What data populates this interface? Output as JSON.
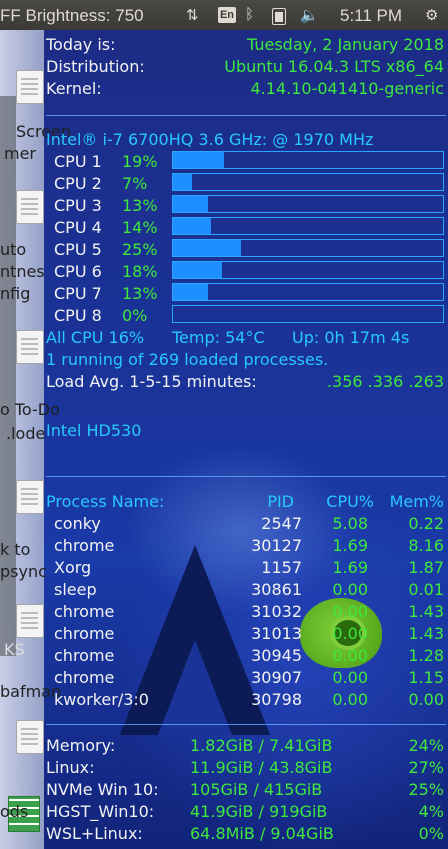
{
  "topbar": {
    "brightness": "FF Brightness: 750",
    "keyboard": "En",
    "time": "5:11 PM",
    "icons": [
      "sync-arrows-icon",
      "keyboard-layout-icon",
      "bluetooth-icon",
      "battery-icon",
      "volume-icon",
      "settings-gear-icon"
    ]
  },
  "dock": {
    "labels": [
      "Screen",
      "mer",
      "uto",
      "ntnes",
      "nfig",
      "o To-Do",
      ".lode",
      "k to",
      "psync",
      "KS",
      "bafman",
      "ods"
    ]
  },
  "system": {
    "today_label": "Today is:",
    "today_value": "Tuesday,  2 January 2018",
    "dist_label": "Distribution:",
    "dist_value": "Ubuntu 16.04.3 LTS x86_64",
    "kernel_label": "Kernel:",
    "kernel_value": "4.14.10-041410-generic"
  },
  "cpu": {
    "model": "Intel® i-7 6700HQ 3.6 GHz: @  1970 MHz",
    "cores": [
      {
        "label": "CPU 1",
        "pct": "19%",
        "value": 19
      },
      {
        "label": "CPU 2",
        "pct": "7%",
        "value": 7
      },
      {
        "label": "CPU 3",
        "pct": "13%",
        "value": 13
      },
      {
        "label": "CPU 4",
        "pct": "14%",
        "value": 14
      },
      {
        "label": "CPU 5",
        "pct": "25%",
        "value": 25
      },
      {
        "label": "CPU 6",
        "pct": "18%",
        "value": 18
      },
      {
        "label": "CPU 7",
        "pct": "13%",
        "value": 13
      },
      {
        "label": "CPU 8",
        "pct": "0%",
        "value": 0
      }
    ],
    "all_cpu": "All CPU 16%",
    "temp": "Temp: 54°C",
    "uptime": "Up: 0h 17m 4s",
    "processes": "1 running of 269 loaded processes.",
    "load_label": "Load Avg. 1-5-15 minutes:",
    "load_value": ".356 .336 .263",
    "gpu": "Intel HD530"
  },
  "processes": {
    "headers": {
      "name": "Process Name:",
      "pid": "PID",
      "cpu": "CPU%",
      "mem": "Mem%"
    },
    "rows": [
      {
        "name": "conky",
        "pid": "2547",
        "cpu": "5.08",
        "mem": "0.22"
      },
      {
        "name": "chrome",
        "pid": "30127",
        "cpu": "1.69",
        "mem": "8.16"
      },
      {
        "name": "Xorg",
        "pid": "1157",
        "cpu": "1.69",
        "mem": "1.87"
      },
      {
        "name": "sleep",
        "pid": "30861",
        "cpu": "0.00",
        "mem": "0.01"
      },
      {
        "name": "chrome",
        "pid": "31032",
        "cpu": "0.00",
        "mem": "1.43"
      },
      {
        "name": "chrome",
        "pid": "31013",
        "cpu": "0.00",
        "mem": "1.43"
      },
      {
        "name": "chrome",
        "pid": "30945",
        "cpu": "0.00",
        "mem": "1.28"
      },
      {
        "name": "chrome",
        "pid": "30907",
        "cpu": "0.00",
        "mem": "1.15"
      },
      {
        "name": "kworker/3:0",
        "pid": "30798",
        "cpu": "0.00",
        "mem": "0.00"
      }
    ]
  },
  "storage": {
    "rows": [
      {
        "name": "Memory:",
        "used": "1.82GiB / 7.41GiB",
        "pct": "24%"
      },
      {
        "name": "Linux:",
        "used": "11.9GiB / 43.8GiB",
        "pct": "27%"
      },
      {
        "name": "NVMe Win 10:",
        "used": "105GiB / 415GiB",
        "pct": "25%"
      },
      {
        "name": "HGST_Win10:",
        "used": "41.9GiB / 919GiB",
        "pct": "4%"
      },
      {
        "name": "WSL+Linux:",
        "used": "64.8MiB / 9.04GiB",
        "pct": "0%"
      }
    ]
  },
  "colors": {
    "label": "#f2f2f2",
    "value_green": "#3ee83e",
    "accent_cyan": "#28c8ff",
    "bar_fill": "#1f8fff",
    "panel": "#3b3a36"
  }
}
